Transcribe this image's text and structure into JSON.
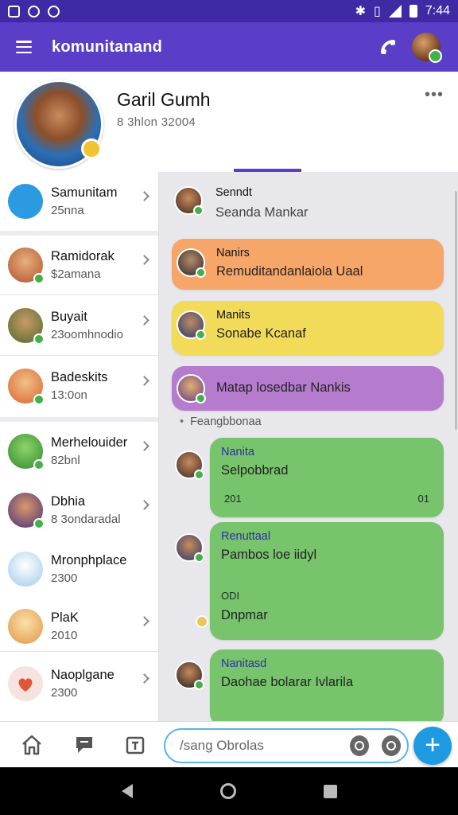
{
  "status_bar": {
    "time": "7:44"
  },
  "app_bar": {
    "title": "komunitanand"
  },
  "profile": {
    "name": "Garil Gumh",
    "subtitle": "8 3hlon 32004",
    "more": "•••"
  },
  "left_list": {
    "items": [
      {
        "title": "Samunitam",
        "subtitle": "25nna",
        "color": "#2a9be0"
      },
      {
        "title": "Ramidorak",
        "subtitle": "$2amana",
        "color": "#d97b4a"
      },
      {
        "title": "Buyait",
        "subtitle": "23oomhnodio",
        "color": "#6a8a3a"
      },
      {
        "title": "Badeskits",
        "subtitle": "13:0on",
        "color": "#e0863a"
      },
      {
        "title": "Merhelouider",
        "subtitle": "82bnl",
        "color": "#4caf50"
      },
      {
        "title": "Dbhia",
        "subtitle": "8 3ondaradal",
        "color": "#6a4aa0"
      },
      {
        "title": "Mronphplace",
        "subtitle": "2300",
        "color": "#9ecbe8"
      },
      {
        "title": "PlaK",
        "subtitle": "2010",
        "color": "#f2c26a"
      },
      {
        "title": "Naoplgane",
        "subtitle": "2300",
        "color": "#f3d9d4"
      }
    ]
  },
  "chat": {
    "first": {
      "name": "Senndt",
      "text": "Seanda Mankar"
    },
    "messages": [
      {
        "name": "Nanirs",
        "text": "Remuditandanlaiola Uaal",
        "color": "#f7a66a"
      },
      {
        "name": "Manits",
        "text": "Sonabe Kcanaf",
        "color": "#f3db5a"
      },
      {
        "name": "",
        "text": "Matap losedbar Nankis",
        "color": "#b57ccd"
      }
    ],
    "system_line": "Feangbbonaa",
    "green_messages": [
      {
        "name": "Nanita",
        "text": "Selpobbrad",
        "meta_left": "201",
        "meta_right": "01"
      },
      {
        "name": "Renuttaal",
        "text": "Pambos loe iidyl",
        "meta_left": "ODI",
        "extra": "Dnpmar"
      },
      {
        "name": "Nanitasd",
        "text": "Daohae bolarar Ivlarila"
      }
    ]
  },
  "bottom_bar": {
    "input_placeholder": "/sang Obrolas",
    "fab": "+"
  }
}
